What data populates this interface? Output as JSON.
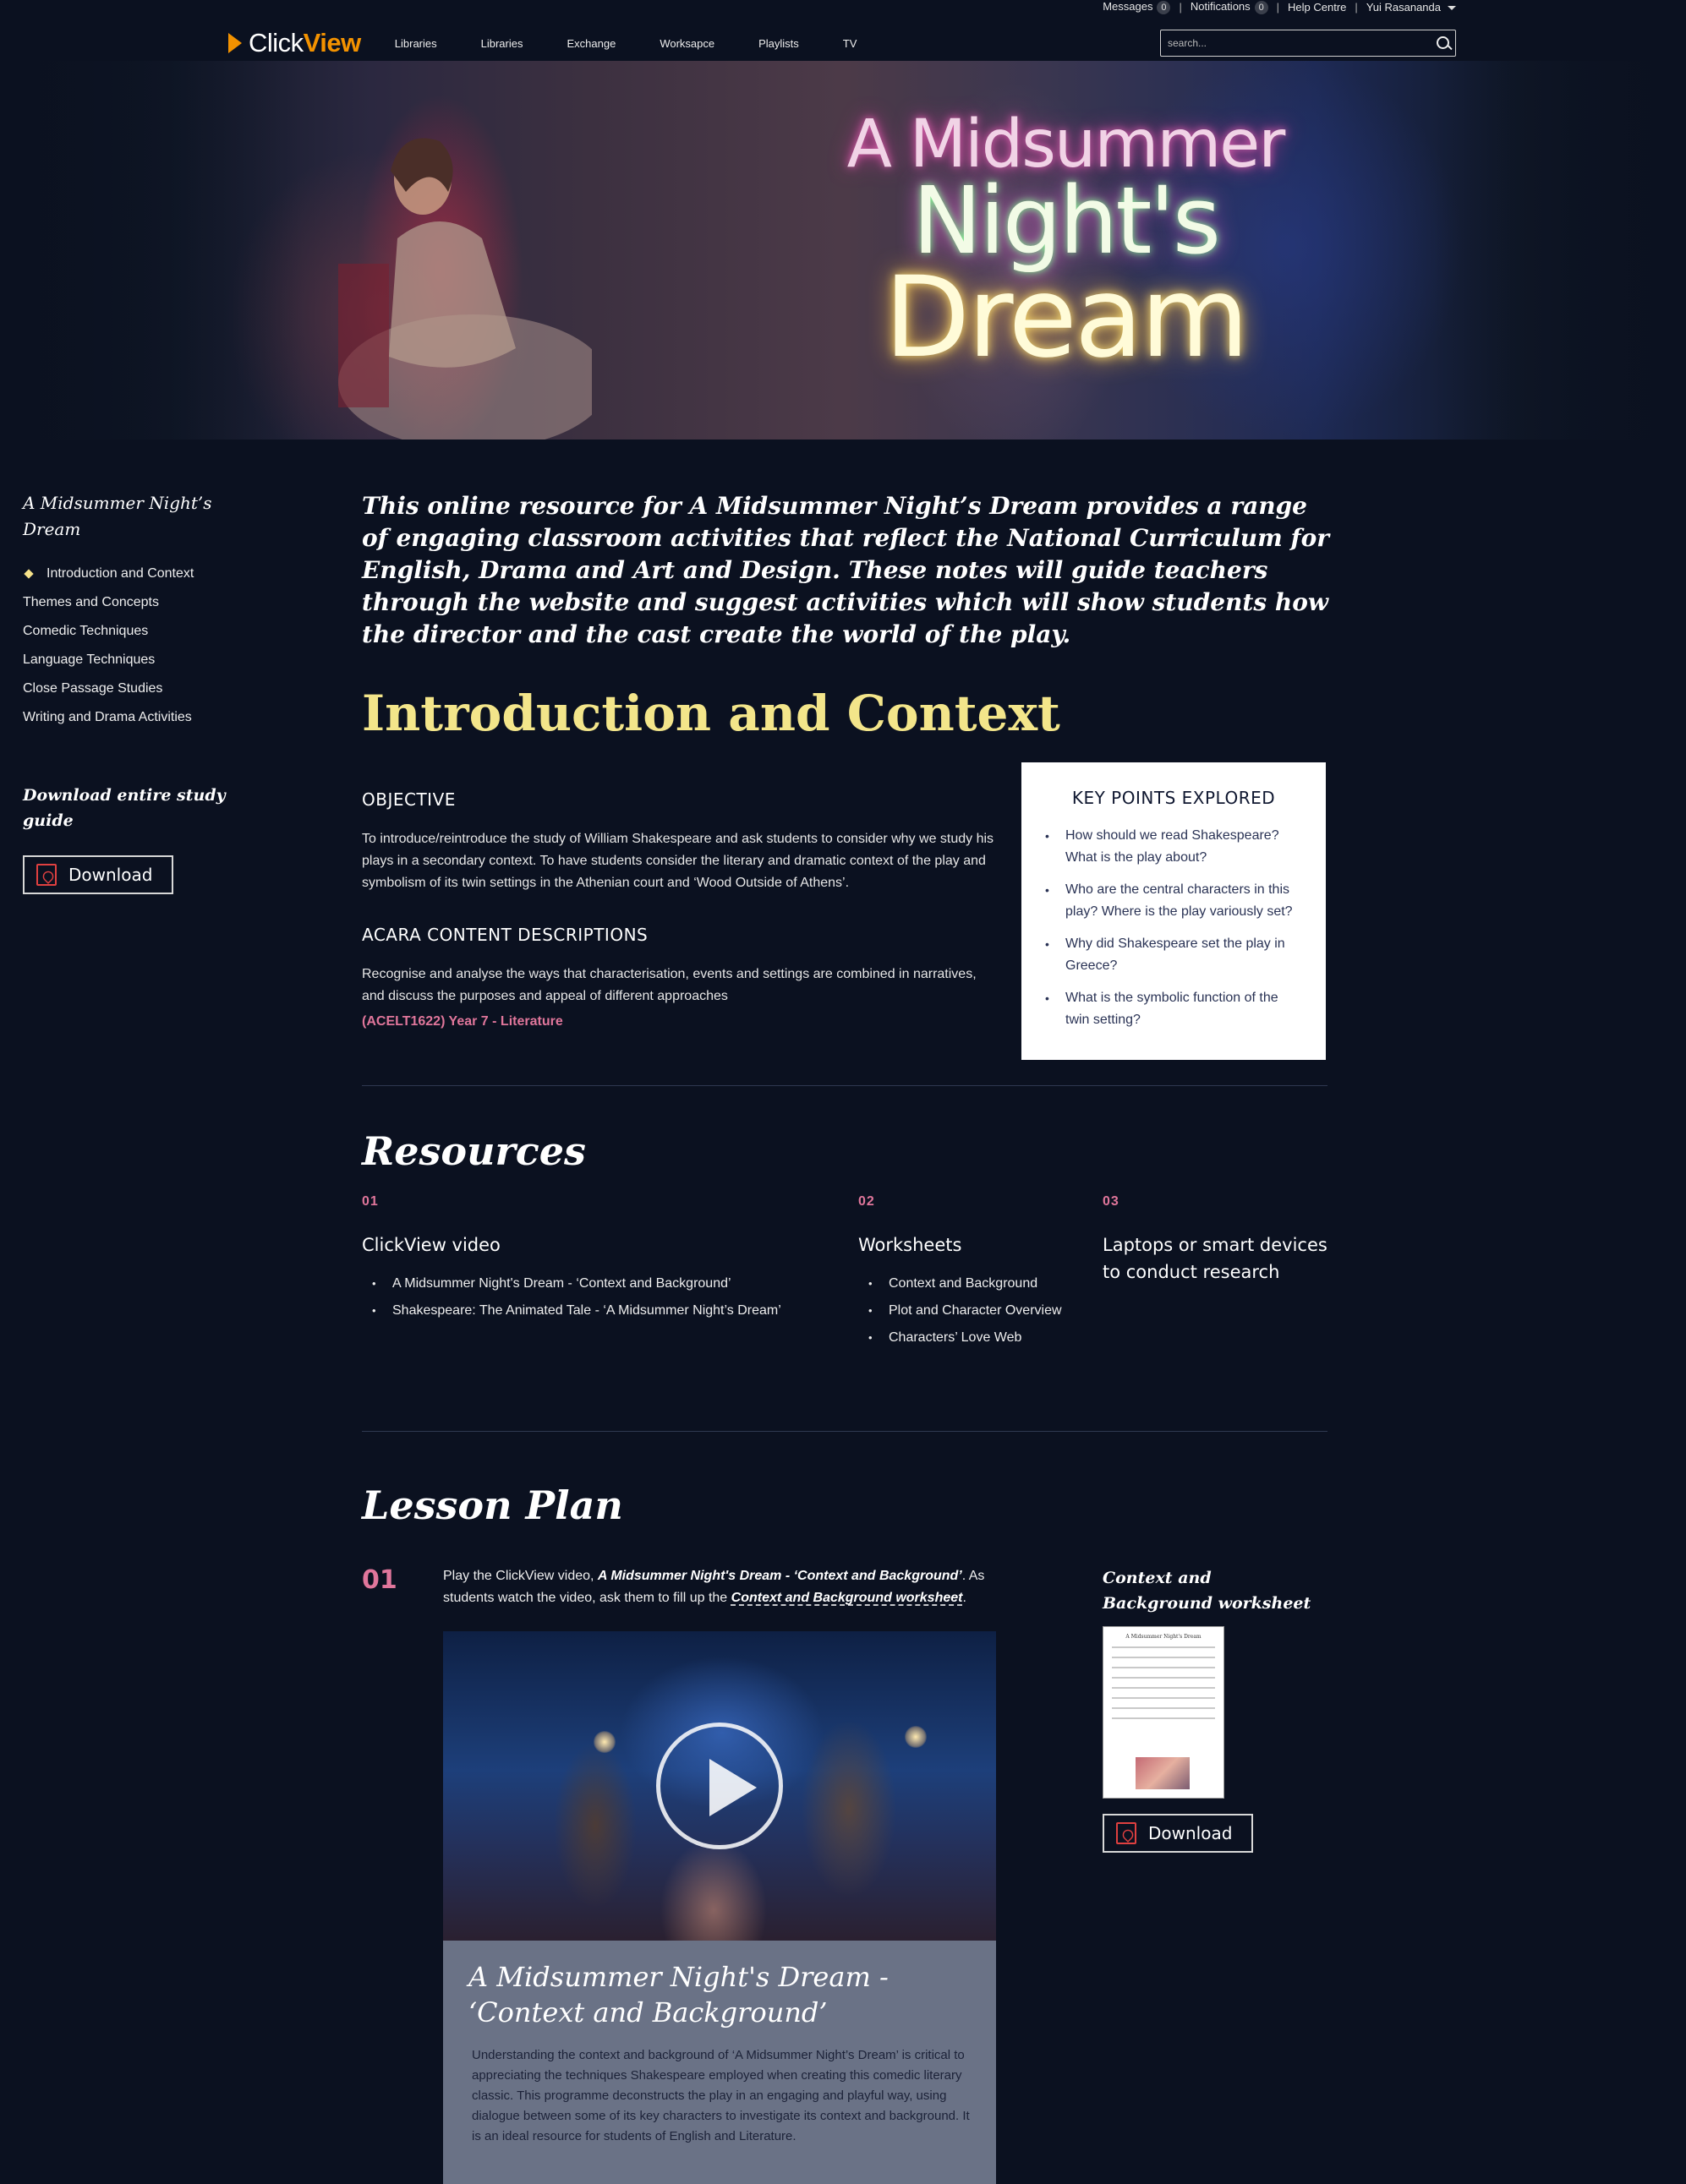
{
  "topbar": {
    "messages_label": "Messages",
    "messages_count": "0",
    "notifications_label": "Notifications",
    "notifications_count": "0",
    "help_label": "Help Centre",
    "user_name": "Yui Rasananda",
    "separator": "|"
  },
  "nav": {
    "logo_part1": "Click",
    "logo_part2": "View",
    "links": [
      "Libraries",
      "Libraries",
      "Exchange",
      "Worksapce",
      "Playlists",
      "TV"
    ],
    "search_placeholder": "search..."
  },
  "hero": {
    "title_line1": "A Midsummer",
    "title_line2": "Night's",
    "title_line3": "Dream"
  },
  "sidebar": {
    "title": "A Midsummer Night’s Dream",
    "items": [
      "Introduction and Context",
      "Themes and Concepts",
      "Comedic Techniques",
      "Language Techniques",
      "Close Passage Studies",
      "Writing and Drama Activities"
    ],
    "download_title": "Download entire study guide",
    "download_label": "Download"
  },
  "main": {
    "intro": "This online resource for A Midsummer Night’s Dream provides a range of engaging classroom activities that reflect the National Curriculum for English, Drama and Art and Design. These notes will guide teachers through the website and suggest activities which will show students how the director and the cast create the world of the play.",
    "section_title": "Introduction and Context",
    "objective_heading": "OBJECTIVE",
    "objective_text": "To introduce/reintroduce the study of William Shakespeare and ask students to consider why we study his plays in a secondary context. To have students consider the literary and dramatic context of the play and symbolism of its twin settings in the Athenian court and ‘Wood Outside of Athens’.",
    "acara_heading": "ACARA CONTENT DESCRIPTIONS",
    "acara_text": "Recognise and analyse the ways that characterisation, events and settings are combined in narratives, and discuss the purposes and appeal of different approaches",
    "acara_code": "(ACELT1622) Year 7 - Literature",
    "key_points": {
      "title": "KEY POINTS EXPLORED",
      "items": [
        "How should we read Shakespeare? What is the play about?",
        "Who are the central characters in this play? Where is the play variously set?",
        "Why did Shakespeare set the play in Greece?",
        "What is the symbolic function of the twin setting?"
      ]
    }
  },
  "resources": {
    "title": "Resources",
    "columns": [
      {
        "num": "01",
        "title": "ClickView video",
        "items": [
          "A Midsummer Night's Dream - ‘Context and Background’",
          "Shakespeare: The Animated Tale - ‘A Midsummer Night’s Dream’"
        ]
      },
      {
        "num": "02",
        "title": "Worksheets",
        "items": [
          "Context and Background",
          "Plot and Character Overview",
          "Characters’ Love Web"
        ]
      },
      {
        "num": "03",
        "title": "Laptops or smart devices to conduct research",
        "items": []
      }
    ]
  },
  "lesson": {
    "title": "Lesson Plan",
    "step1": {
      "num": "01",
      "text_a": "Play the ClickView video, ",
      "video_link": "A Midsummer Night's Dream - ‘Context and Background’",
      "text_b": ". As students watch the video, ask them to fill up the ",
      "worksheet_link": "Context and Background worksheet",
      "text_c": ".",
      "video_title": "A Midsummer Night's Dream - ‘Context and Background’",
      "video_desc": "Understanding the context and background of ‘A Midsummer Night’s Dream’ is critical to appreciating the techniques Shakespeare employed when creating this comedic literary classic. This programme deconstructs the play in an engaging and playful way, using dialogue between some of its key characters to investigate its context and background. It is an ideal resource for students of English and Literature.",
      "worksheet_title": "Context and Background worksheet",
      "worksheet_doc_title": "A Midsummer Night's Dream",
      "download_label": "Download"
    }
  }
}
